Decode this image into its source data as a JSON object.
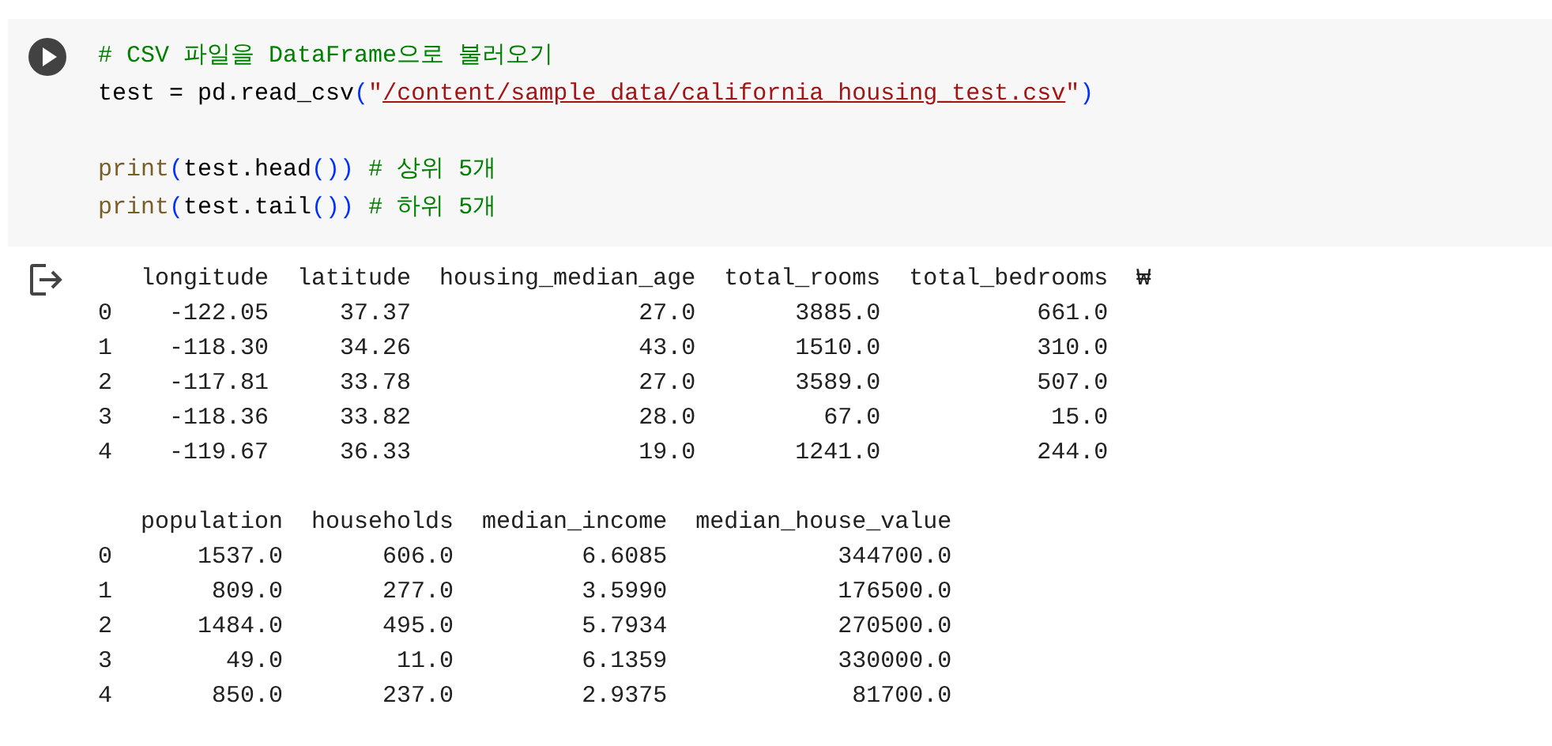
{
  "code_cell": {
    "lines": [
      {
        "kind": "code",
        "tokens": [
          {
            "kind": "comment",
            "text": "# CSV 파일을 DataFrame으로 불러오기"
          }
        ]
      },
      {
        "kind": "code",
        "tokens": [
          {
            "kind": "plain",
            "text": "test = pd.read_csv"
          },
          {
            "kind": "paren",
            "text": "("
          },
          {
            "kind": "string",
            "text": "\""
          },
          {
            "kind": "path",
            "text": "/content/sample_data/california_housing_test.csv"
          },
          {
            "kind": "string",
            "text": "\""
          },
          {
            "kind": "paren",
            "text": ")"
          }
        ]
      },
      {
        "kind": "blank"
      },
      {
        "kind": "code",
        "tokens": [
          {
            "kind": "builtin",
            "text": "print"
          },
          {
            "kind": "paren",
            "text": "("
          },
          {
            "kind": "plain",
            "text": "test.head"
          },
          {
            "kind": "paren",
            "text": "())"
          },
          {
            "kind": "comment",
            "text": " # 상위 5개"
          }
        ]
      },
      {
        "kind": "code",
        "tokens": [
          {
            "kind": "builtin",
            "text": "print"
          },
          {
            "kind": "paren",
            "text": "("
          },
          {
            "kind": "plain",
            "text": "test.tail"
          },
          {
            "kind": "paren",
            "text": "())"
          },
          {
            "kind": "comment",
            "text": " # 하위 5개"
          }
        ]
      }
    ]
  },
  "output": {
    "tables": [
      {
        "columns": [
          "longitude",
          "latitude",
          "housing_median_age",
          "total_rooms",
          "total_bedrooms"
        ],
        "continuation": "₩",
        "rows": [
          {
            "index": "0",
            "cells": [
              "-122.05",
              "37.37",
              "27.0",
              "3885.0",
              "661.0"
            ]
          },
          {
            "index": "1",
            "cells": [
              "-118.30",
              "34.26",
              "43.0",
              "1510.0",
              "310.0"
            ]
          },
          {
            "index": "2",
            "cells": [
              "-117.81",
              "33.78",
              "27.0",
              "3589.0",
              "507.0"
            ]
          },
          {
            "index": "3",
            "cells": [
              "-118.36",
              "33.82",
              "28.0",
              "67.0",
              "15.0"
            ]
          },
          {
            "index": "4",
            "cells": [
              "-119.67",
              "36.33",
              "19.0",
              "1241.0",
              "244.0"
            ]
          }
        ]
      },
      {
        "columns": [
          "population",
          "households",
          "median_income",
          "median_house_value"
        ],
        "rows": [
          {
            "index": "0",
            "cells": [
              "1537.0",
              "606.0",
              "6.6085",
              "344700.0"
            ]
          },
          {
            "index": "1",
            "cells": [
              "809.0",
              "277.0",
              "3.5990",
              "176500.0"
            ]
          },
          {
            "index": "2",
            "cells": [
              "1484.0",
              "495.0",
              "5.7934",
              "270500.0"
            ]
          },
          {
            "index": "3",
            "cells": [
              "49.0",
              "11.0",
              "6.1359",
              "330000.0"
            ]
          },
          {
            "index": "4",
            "cells": [
              "850.0",
              "237.0",
              "2.9375",
              "81700.0"
            ]
          }
        ]
      }
    ]
  }
}
